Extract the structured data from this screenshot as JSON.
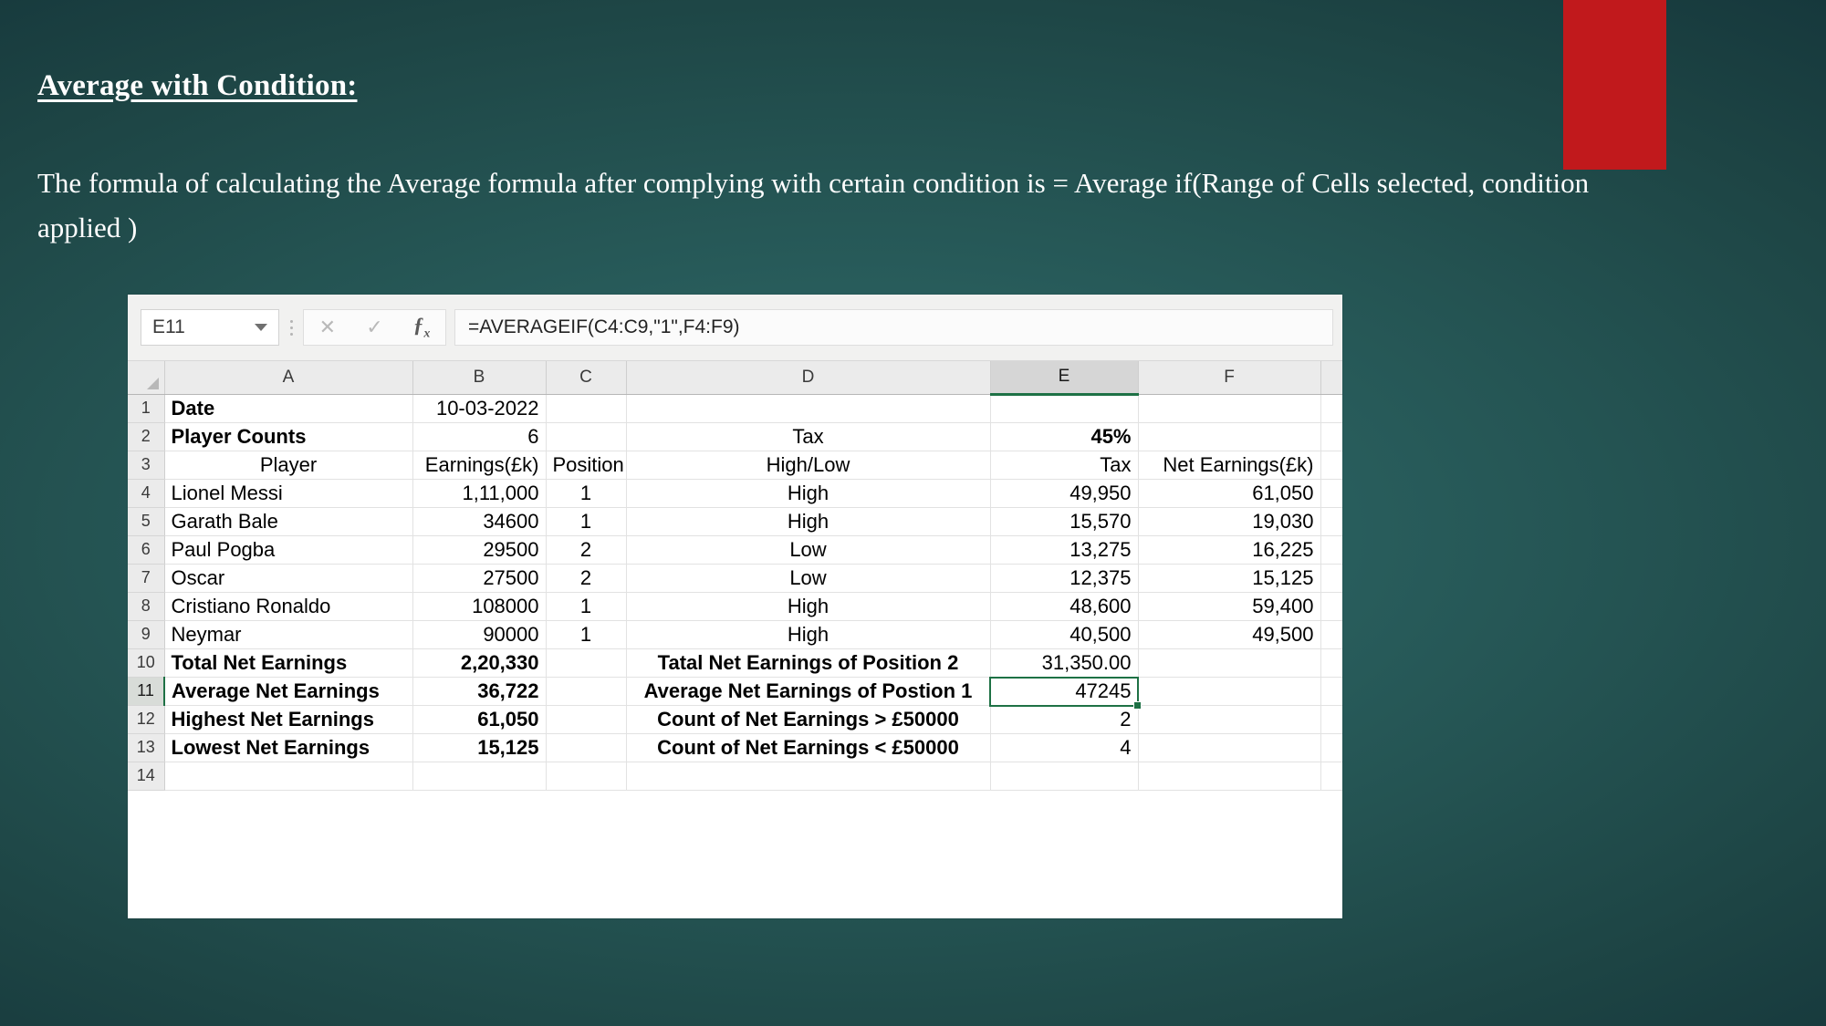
{
  "slide": {
    "title": "Average with Condition:",
    "body": "The formula of calculating the Average formula after complying with certain condition is = Average if(Range of Cells selected, condition applied )",
    "accent_red": "#c1191c",
    "background_teal": "#245352"
  },
  "excel": {
    "name_box_value": "E11",
    "formula_value": "=AVERAGEIF(C4:C9,\"1\",F4:F9)",
    "cancel_icon": "close-icon",
    "confirm_icon": "check-icon",
    "function_icon": "fx-icon",
    "dropdown_icon": "chevron-down-icon",
    "selected_cell": "E11",
    "selection_color": "#1e7145",
    "column_headers": [
      "A",
      "B",
      "C",
      "D",
      "E",
      "F"
    ],
    "selected_column": "E",
    "selected_row": "11",
    "row_numbers": [
      "1",
      "2",
      "3",
      "4",
      "5",
      "6",
      "7",
      "8",
      "9",
      "10",
      "11",
      "12",
      "13",
      "14"
    ],
    "rows": [
      {
        "n": "1",
        "a": "Date",
        "b": "10-03-2022",
        "c": "",
        "d": "",
        "e": "",
        "f": ""
      },
      {
        "n": "2",
        "a": "Player Counts",
        "b": "6",
        "c": "",
        "d": "Tax",
        "e": "45%",
        "f": ""
      },
      {
        "n": "3",
        "a": "Player",
        "b": "Earnings(£k)",
        "c": "Position",
        "d": "High/Low",
        "e": "Tax",
        "f": "Net Earnings(£k)"
      },
      {
        "n": "4",
        "a": "Lionel Messi",
        "b": "1,11,000",
        "c": "1",
        "d": "High",
        "e": "49,950",
        "f": "61,050"
      },
      {
        "n": "5",
        "a": "Garath Bale",
        "b": "34600",
        "c": "1",
        "d": "High",
        "e": "15,570",
        "f": "19,030"
      },
      {
        "n": "6",
        "a": "Paul Pogba",
        "b": "29500",
        "c": "2",
        "d": "Low",
        "e": "13,275",
        "f": "16,225"
      },
      {
        "n": "7",
        "a": "Oscar",
        "b": "27500",
        "c": "2",
        "d": "Low",
        "e": "12,375",
        "f": "15,125"
      },
      {
        "n": "8",
        "a": "Cristiano Ronaldo",
        "b": "108000",
        "c": "1",
        "d": "High",
        "e": "48,600",
        "f": "59,400"
      },
      {
        "n": "9",
        "a": "Neymar",
        "b": "90000",
        "c": "1",
        "d": "High",
        "e": "40,500",
        "f": "49,500"
      },
      {
        "n": "10",
        "a": "Total Net Earnings",
        "b": "2,20,330",
        "c": "",
        "d": "Tatal Net Earnings of Position 2",
        "e": "31,350.00",
        "f": ""
      },
      {
        "n": "11",
        "a": "Average Net Earnings",
        "b": "36,722",
        "c": "",
        "d": "Average Net Earnings of Postion 1",
        "e": "47245",
        "f": ""
      },
      {
        "n": "12",
        "a": "Highest Net Earnings",
        "b": "61,050",
        "c": "",
        "d": " Count of Net Earnings > £50000",
        "e": "2",
        "f": ""
      },
      {
        "n": "13",
        "a": "Lowest Net Earnings",
        "b": "15,125",
        "c": "",
        "d": "Count of Net Earnings < £50000",
        "e": "4",
        "f": ""
      },
      {
        "n": "14",
        "a": "",
        "b": "",
        "c": "",
        "d": "",
        "e": "",
        "f": ""
      }
    ]
  }
}
